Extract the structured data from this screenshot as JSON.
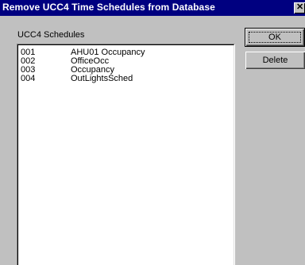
{
  "window": {
    "title": "Remove UCC4 Time Schedules from Database",
    "close_glyph": "✕"
  },
  "schedules": {
    "label": "UCC4 Schedules",
    "items": [
      {
        "number": "001",
        "name": "AHU01 Occupancy"
      },
      {
        "number": "002",
        "name": "OfficeOcc"
      },
      {
        "number": "003",
        "name": "Occupancy"
      },
      {
        "number": "004",
        "name": "OutLightsSched"
      }
    ]
  },
  "buttons": {
    "ok": "OK",
    "delete": "Delete"
  }
}
